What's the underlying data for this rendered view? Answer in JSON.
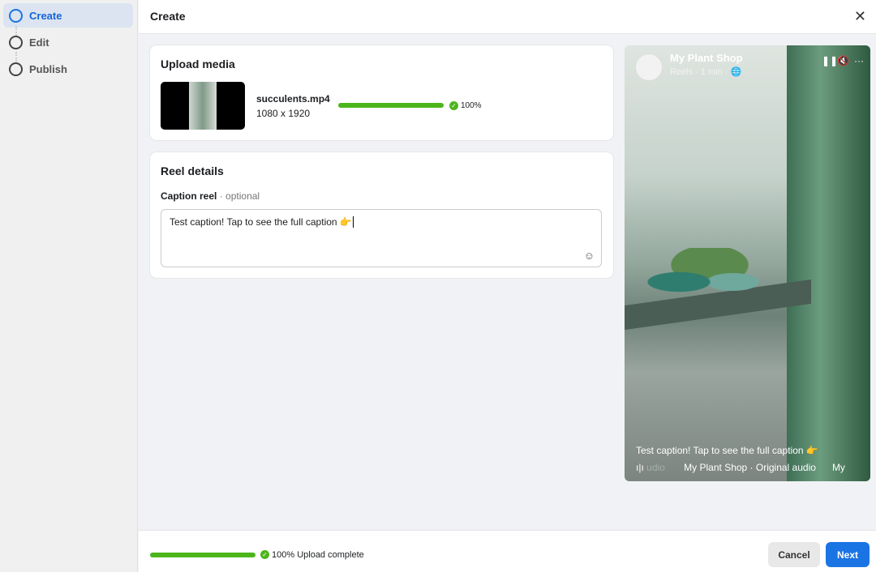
{
  "sidebar": {
    "steps": [
      {
        "label": "Create",
        "active": true
      },
      {
        "label": "Edit"
      },
      {
        "label": "Publish"
      }
    ]
  },
  "header": {
    "title": "Create",
    "close_icon": "close-icon"
  },
  "upload": {
    "title": "Upload media",
    "file_name": "succulents.mp4",
    "dimensions": "1080 x 1920",
    "progress": 100,
    "progress_label": "100%"
  },
  "details": {
    "title": "Reel details",
    "caption_label": "Caption reel",
    "separator": "·",
    "optional": "optional",
    "caption_value": "Test caption! Tap to see the full caption 👉"
  },
  "preview": {
    "page_name": "My Plant Shop",
    "meta": "Reels · 1 min · ",
    "caption": "Test caption! Tap to see the full caption 👉",
    "audio_prefix": "udio",
    "audio": "My Plant Shop · Original audio",
    "audio_next": "My"
  },
  "footer": {
    "progress": 100,
    "status": "100% Upload complete",
    "cancel_label": "Cancel",
    "next_label": "Next"
  },
  "colors": {
    "accent": "#1b74e4",
    "success": "#4cb51c"
  }
}
